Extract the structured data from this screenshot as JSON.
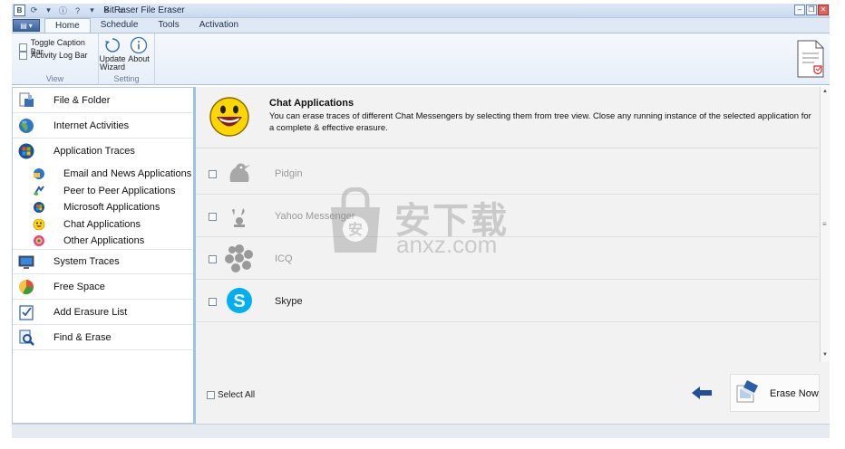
{
  "window": {
    "title": "BitRaser File Eraser"
  },
  "ribbon": {
    "tabs": [
      {
        "label": "Home",
        "active": true
      },
      {
        "label": "Schedule",
        "active": false
      },
      {
        "label": "Tools",
        "active": false
      },
      {
        "label": "Activation",
        "active": false
      }
    ],
    "view_group": {
      "label": "View",
      "toggle_caption_bar": "Toggle Caption Bar",
      "activity_log_bar": "Activity Log Bar"
    },
    "setting_group": {
      "label": "Setting",
      "update_wizard_line1": "Update",
      "update_wizard_line2": "Wizard",
      "about": "About"
    }
  },
  "sidebar": {
    "items": [
      {
        "label": "File & Folder",
        "icon": "file-folder-icon"
      },
      {
        "label": "Internet Activities",
        "icon": "globe-icon"
      },
      {
        "label": "Application Traces",
        "icon": "windows-icon"
      },
      {
        "label": "System Traces",
        "icon": "monitor-icon"
      },
      {
        "label": "Free Space",
        "icon": "pie-chart-icon"
      },
      {
        "label": "Add Erasure List",
        "icon": "checklist-icon"
      },
      {
        "label": "Find & Erase",
        "icon": "magnifier-icon"
      }
    ],
    "subitems": [
      {
        "label": "Email and News Applications",
        "icon": "email-app-icon"
      },
      {
        "label": "Peer to Peer Applications",
        "icon": "p2p-icon"
      },
      {
        "label": "Microsoft Applications",
        "icon": "microsoft-icon"
      },
      {
        "label": "Chat Applications",
        "icon": "chat-smiley-icon"
      },
      {
        "label": "Other Applications",
        "icon": "other-apps-icon"
      }
    ]
  },
  "main": {
    "title": "Chat Applications",
    "description": "You can erase traces of different Chat Messengers by selecting them from tree view. Close any running instance of the selected application for a complete & effective erasure.",
    "apps": [
      {
        "name": "Pidgin",
        "icon": "pidgin-icon",
        "enabled": false
      },
      {
        "name": "Yahoo Messenger",
        "icon": "yahoo-messenger-icon",
        "enabled": false
      },
      {
        "name": "ICQ",
        "icon": "icq-icon",
        "enabled": false
      },
      {
        "name": "Skype",
        "icon": "skype-icon",
        "enabled": true
      }
    ],
    "select_all": "Select All",
    "erase_now": "Erase Now"
  },
  "watermark": {
    "text_cn": "安下载",
    "text_en": "anxz.com"
  },
  "colors": {
    "accent": "#2a5ea8",
    "splitter": "#9cc3e3",
    "panel_bg": "#f2f2f2"
  }
}
